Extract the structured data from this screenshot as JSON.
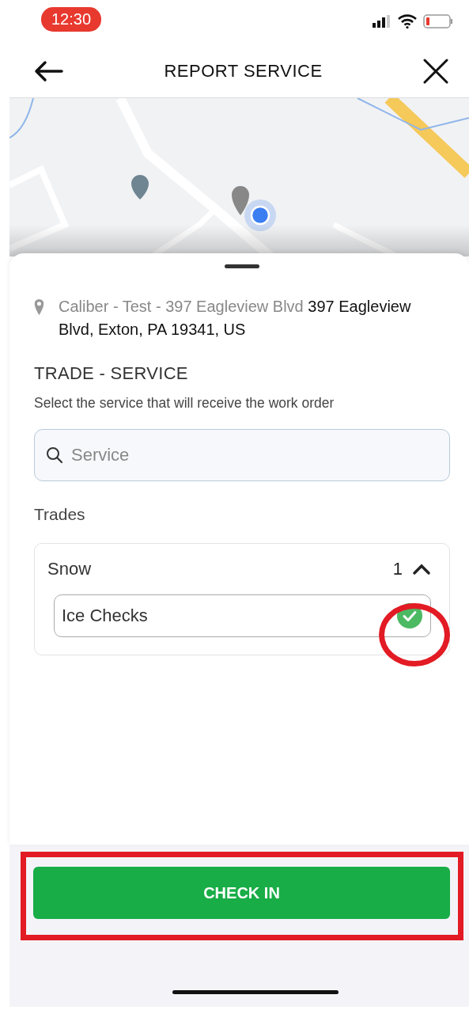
{
  "status_bar": {
    "time": "12:30"
  },
  "header": {
    "title": "REPORT SERVICE"
  },
  "location": {
    "name": "Caliber - Test - 397 Eagleview Blvd",
    "address": "397 Eagleview Blvd, Exton, PA 19341, US"
  },
  "section": {
    "title": "TRADE - SERVICE",
    "subtitle": "Select the service that will receive the work order"
  },
  "search": {
    "placeholder": "Service"
  },
  "trades_label": "Trades",
  "trades": [
    {
      "name": "Snow",
      "count": "1",
      "expanded": true,
      "services": [
        {
          "name": "Ice Checks",
          "selected": true
        }
      ]
    }
  ],
  "primary_button": "CHECK IN",
  "annotations": [
    {
      "kind": "ellipse"
    },
    {
      "kind": "rectangle"
    }
  ]
}
